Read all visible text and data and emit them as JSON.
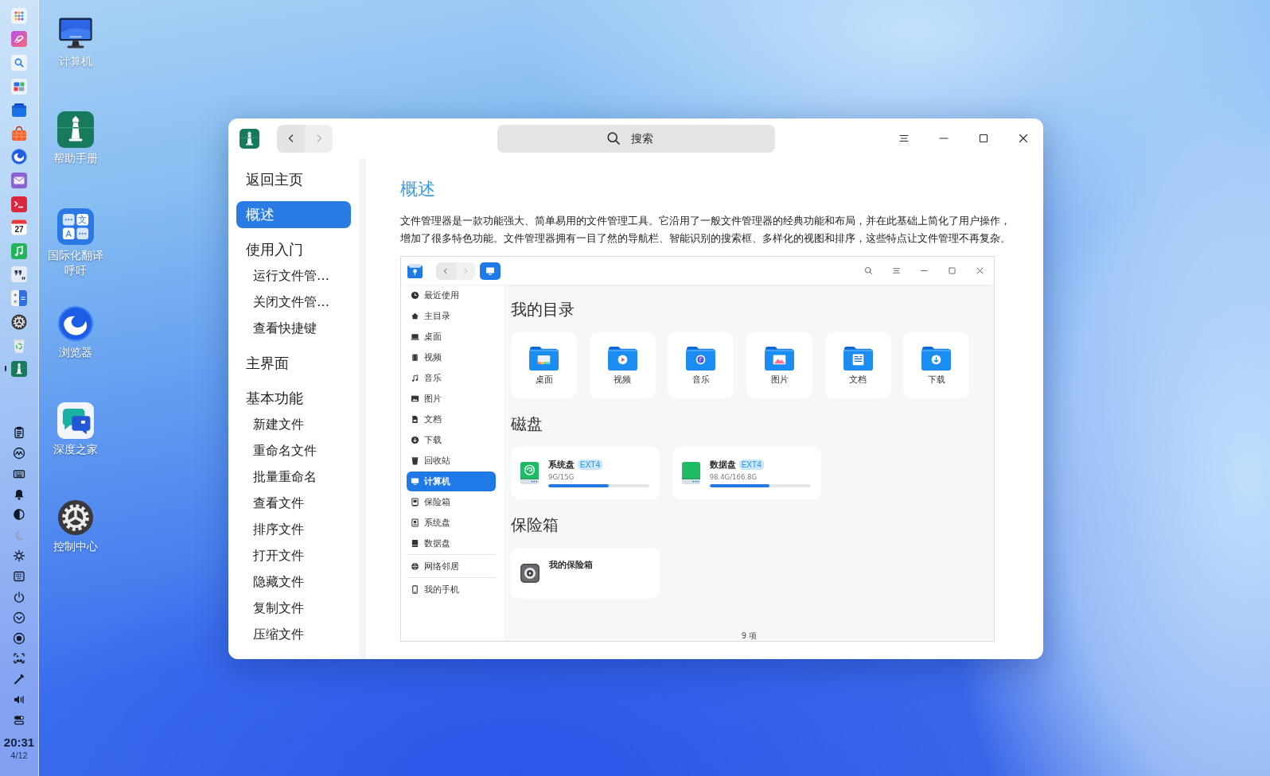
{
  "dock": {
    "apps": [
      {
        "kind": "launcher",
        "running": false
      },
      {
        "kind": "loops",
        "running": false
      },
      {
        "kind": "search",
        "running": false
      },
      {
        "kind": "blocks",
        "running": false
      },
      {
        "kind": "box",
        "running": false
      },
      {
        "kind": "bag",
        "running": false
      },
      {
        "kind": "browser",
        "running": false
      },
      {
        "kind": "mail",
        "running": false
      },
      {
        "kind": "terminal",
        "running": false
      },
      {
        "kind": "calendar",
        "day": "27",
        "running": false
      },
      {
        "kind": "music",
        "running": false
      },
      {
        "kind": "quote",
        "running": false
      },
      {
        "kind": "calculator",
        "running": false
      },
      {
        "kind": "settings",
        "running": false
      },
      {
        "kind": "recycle",
        "running": false
      },
      {
        "kind": "manual",
        "running": true
      }
    ],
    "tray": [
      {
        "kind": "clipboard",
        "disabled": false
      },
      {
        "kind": "monitor",
        "disabled": false
      },
      {
        "kind": "keyboard",
        "disabled": false
      },
      {
        "kind": "bell",
        "disabled": false
      },
      {
        "kind": "contrast",
        "disabled": false
      },
      {
        "kind": "moon",
        "disabled": true
      },
      {
        "kind": "sun",
        "disabled": false
      },
      {
        "kind": "keypad",
        "disabled": false
      },
      {
        "kind": "power",
        "disabled": false
      },
      {
        "kind": "expand",
        "disabled": false
      },
      {
        "kind": "record",
        "disabled": false
      },
      {
        "kind": "screenshot",
        "disabled": false
      },
      {
        "kind": "picker",
        "disabled": false
      },
      {
        "kind": "volume",
        "disabled": false
      },
      {
        "kind": "toggles",
        "disabled": false
      }
    ],
    "clock": {
      "time": "20:31",
      "date": "4/12"
    }
  },
  "desktop_icons": [
    {
      "label": "计算机",
      "kind": "computer"
    },
    {
      "label": "帮助手册",
      "kind": "manual"
    },
    {
      "label": "国际化翻译呼吁",
      "kind": "translator",
      "glyphs": [
        "文",
        "A"
      ]
    },
    {
      "label": "浏览器",
      "kind": "browser"
    },
    {
      "label": "深度之家",
      "kind": "chat"
    },
    {
      "label": "控制中心",
      "kind": "settings"
    }
  ],
  "window": {
    "nav": [
      {
        "kind": "back",
        "disabled": false
      },
      {
        "kind": "forward",
        "disabled": true
      }
    ],
    "search": {
      "placeholder": "搜索"
    },
    "sidebar": {
      "items": [
        {
          "label": "返回主页",
          "selected": false
        },
        {
          "label": "概述",
          "selected": true
        },
        {
          "label": "使用入门",
          "selected": false,
          "children": [
            {
              "label": "运行文件管…",
              "selected": false
            },
            {
              "label": "关闭文件管…",
              "selected": false
            },
            {
              "label": "查看快捷键",
              "selected": false
            }
          ]
        },
        {
          "label": "主界面",
          "selected": false
        },
        {
          "label": "基本功能",
          "selected": false,
          "children": [
            {
              "label": "新建文件",
              "selected": false
            },
            {
              "label": "重命名文件",
              "selected": false
            },
            {
              "label": "批量重命名",
              "selected": false
            },
            {
              "label": "查看文件",
              "selected": false
            },
            {
              "label": "排序文件",
              "selected": false
            },
            {
              "label": "打开文件",
              "selected": false
            },
            {
              "label": "隐藏文件",
              "selected": false
            },
            {
              "label": "复制文件",
              "selected": false
            },
            {
              "label": "压缩文件",
              "selected": false
            }
          ]
        }
      ]
    },
    "content": {
      "title": "概述",
      "paragraph": "文件管理器是一款功能强大、简单易用的文件管理工具。它沿用了一般文件管理器的经典功能和布局，并在此基础上简化了用户操作，增加了很多特色功能。文件管理器拥有一目了然的导航栏、智能识别的搜索框、多样化的视图和排序，这些特点让文件管理不再复杂。",
      "screenshot": {
        "nav": [
          {
            "kind": "back",
            "disabled": false
          },
          {
            "kind": "forward",
            "disabled": true
          }
        ],
        "sidebar": {
          "groups": [
            {
              "items": [
                {
                  "label": "最近使用",
                  "selected": false
                },
                {
                  "label": "主目录",
                  "selected": false
                },
                {
                  "label": "桌面",
                  "selected": false
                },
                {
                  "label": "视频",
                  "selected": false
                },
                {
                  "label": "音乐",
                  "selected": false
                },
                {
                  "label": "图片",
                  "selected": false
                },
                {
                  "label": "文档",
                  "selected": false
                },
                {
                  "label": "下载",
                  "selected": false
                },
                {
                  "label": "回收站",
                  "selected": false
                },
                {
                  "label": "计算机",
                  "selected": true
                },
                {
                  "label": "保险箱",
                  "selected": false
                },
                {
                  "label": "系统盘",
                  "selected": false
                },
                {
                  "label": "数据盘",
                  "selected": false
                }
              ]
            },
            {
              "items": [
                {
                  "label": "网络邻居",
                  "selected": false
                }
              ]
            },
            {
              "items": [
                {
                  "label": "我的手机",
                  "selected": false
                }
              ]
            }
          ]
        },
        "sections": [
          {
            "heading": "我的目录",
            "kind": "folders",
            "items": [
              {
                "label": "桌面"
              },
              {
                "label": "视频"
              },
              {
                "label": "音乐"
              },
              {
                "label": "图片"
              },
              {
                "label": "文档"
              },
              {
                "label": "下载"
              }
            ]
          },
          {
            "heading": "磁盘",
            "kind": "disks",
            "items": [
              {
                "name": "系统盘",
                "fs": "EXT4",
                "usage": "9G/15G",
                "level": 0.6
              },
              {
                "name": "数据盘",
                "fs": "EXT4",
                "usage": "98.4G/166.8G",
                "level": 0.59
              }
            ]
          },
          {
            "heading": "保险箱",
            "kind": "vaults",
            "items": [
              {
                "name": "我的保险箱"
              }
            ]
          }
        ],
        "status": "9 项"
      }
    }
  }
}
